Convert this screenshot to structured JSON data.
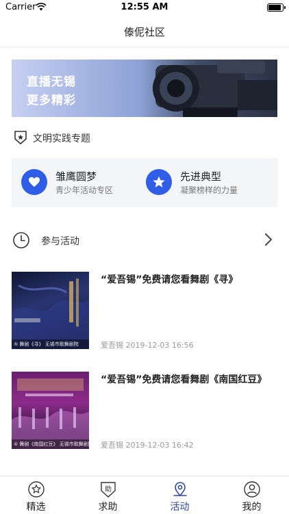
{
  "status_bar": {
    "carrier": "Carrier",
    "time": "12:55 AM"
  },
  "nav": {
    "title": "傣伲社区"
  },
  "banner": {
    "line1": "直播无锡",
    "line2": "更多精彩"
  },
  "section": {
    "title": "文明实践专题"
  },
  "features": [
    {
      "title": "雏鹰圆梦",
      "subtitle": "青少年活动专区",
      "icon": "heart-icon"
    },
    {
      "title": "先进典型",
      "subtitle": "凝聚榜样的力量",
      "icon": "star-icon"
    }
  ],
  "activity": {
    "label": "参与活动"
  },
  "news": [
    {
      "title": "“爱吾锡”免费请您看舞剧《寻》",
      "source": "爱吾锡",
      "datetime": "2019-12-03 16:56",
      "thumb_caption": "⑤ 舞剧《寻》 无锡市歌舞剧院"
    },
    {
      "title": "“爱吾锡”免费请您看舞剧《南国红豆》",
      "source": "爱吾锡",
      "datetime": "2019-12-03 16:42",
      "thumb_caption": "④ 舞剧《南国红豆》 无锡市歌舞剧院"
    }
  ],
  "tabs": [
    {
      "label": "精选",
      "icon": "star-circle-icon",
      "active": false
    },
    {
      "label": "求助",
      "icon": "help-shield-icon",
      "active": false
    },
    {
      "label": "活动",
      "icon": "location-pin-icon",
      "active": true
    },
    {
      "label": "我的",
      "icon": "user-icon",
      "active": false
    }
  ],
  "colors": {
    "accent": "#2f5de6",
    "active_tab": "#2f4a9e"
  }
}
